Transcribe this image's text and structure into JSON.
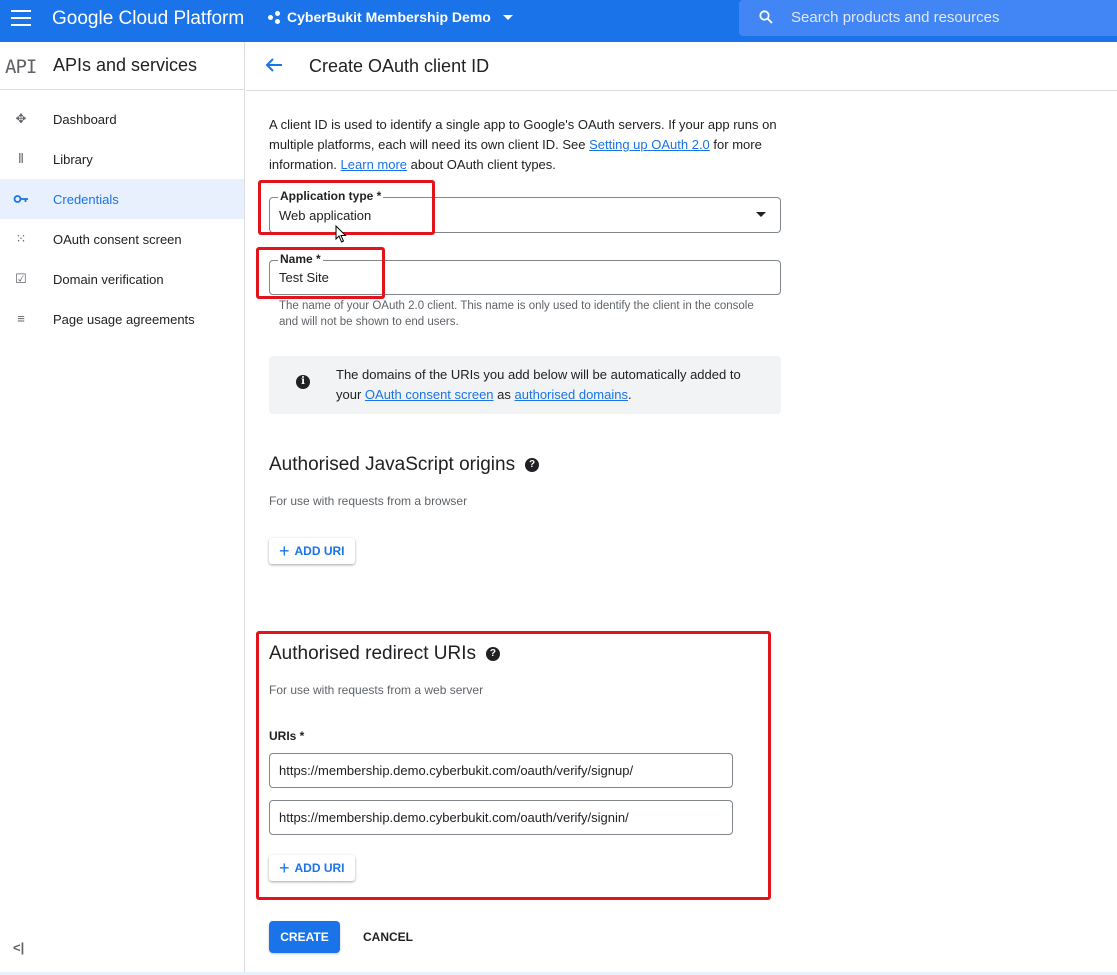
{
  "topbar": {
    "brand": "Google Cloud Platform",
    "project": "CyberBukit Membership Demo",
    "search_placeholder": "Search products and resources"
  },
  "sidebar": {
    "logo": "API",
    "title": "APIs and services",
    "items": [
      {
        "label": "Dashboard",
        "icon": "dashboard-icon"
      },
      {
        "label": "Library",
        "icon": "library-icon"
      },
      {
        "label": "Credentials",
        "icon": "key-icon",
        "active": true
      },
      {
        "label": "OAuth consent screen",
        "icon": "consent-icon"
      },
      {
        "label": "Domain verification",
        "icon": "checkbox-icon"
      },
      {
        "label": "Page usage agreements",
        "icon": "settings-list-icon"
      }
    ],
    "collapse": "<|"
  },
  "header": {
    "title": "Create OAuth client ID"
  },
  "intro": {
    "text_before": "A client ID is used to identify a single app to Google's OAuth servers. If your app runs on multiple platforms, each will need its own client ID. See ",
    "link1": "Setting up OAuth 2.0",
    "text_middle": " for more information. ",
    "link2": "Learn more",
    "text_after": " about OAuth client types."
  },
  "form": {
    "app_type_label": "Application type *",
    "app_type_value": "Web application",
    "name_label": "Name *",
    "name_value": "Test Site",
    "name_hint": "The name of your OAuth 2.0 client. This name is only used to identify the client in the console and will not be shown to end users."
  },
  "info": {
    "text_before": "The domains of the URIs you add below will be automatically added to your ",
    "link1": "OAuth consent screen",
    "text_middle": " as ",
    "link2": "authorised domains",
    "text_after": "."
  },
  "js_origins": {
    "title": "Authorised JavaScript origins",
    "subtitle": "For use with requests from a browser",
    "add_label": "ADD URI"
  },
  "redirect_uris": {
    "title": "Authorised redirect URIs",
    "subtitle": "For use with requests from a web server",
    "uris_label": "URIs *",
    "uris": [
      "https://membership.demo.cyberbukit.com/oauth/verify/signup/",
      "https://membership.demo.cyberbukit.com/oauth/verify/signin/"
    ],
    "add_label": "ADD URI"
  },
  "actions": {
    "create": "CREATE",
    "cancel": "CANCEL"
  },
  "colors": {
    "primary": "#1a73e8",
    "annotation": "#e3131b"
  }
}
